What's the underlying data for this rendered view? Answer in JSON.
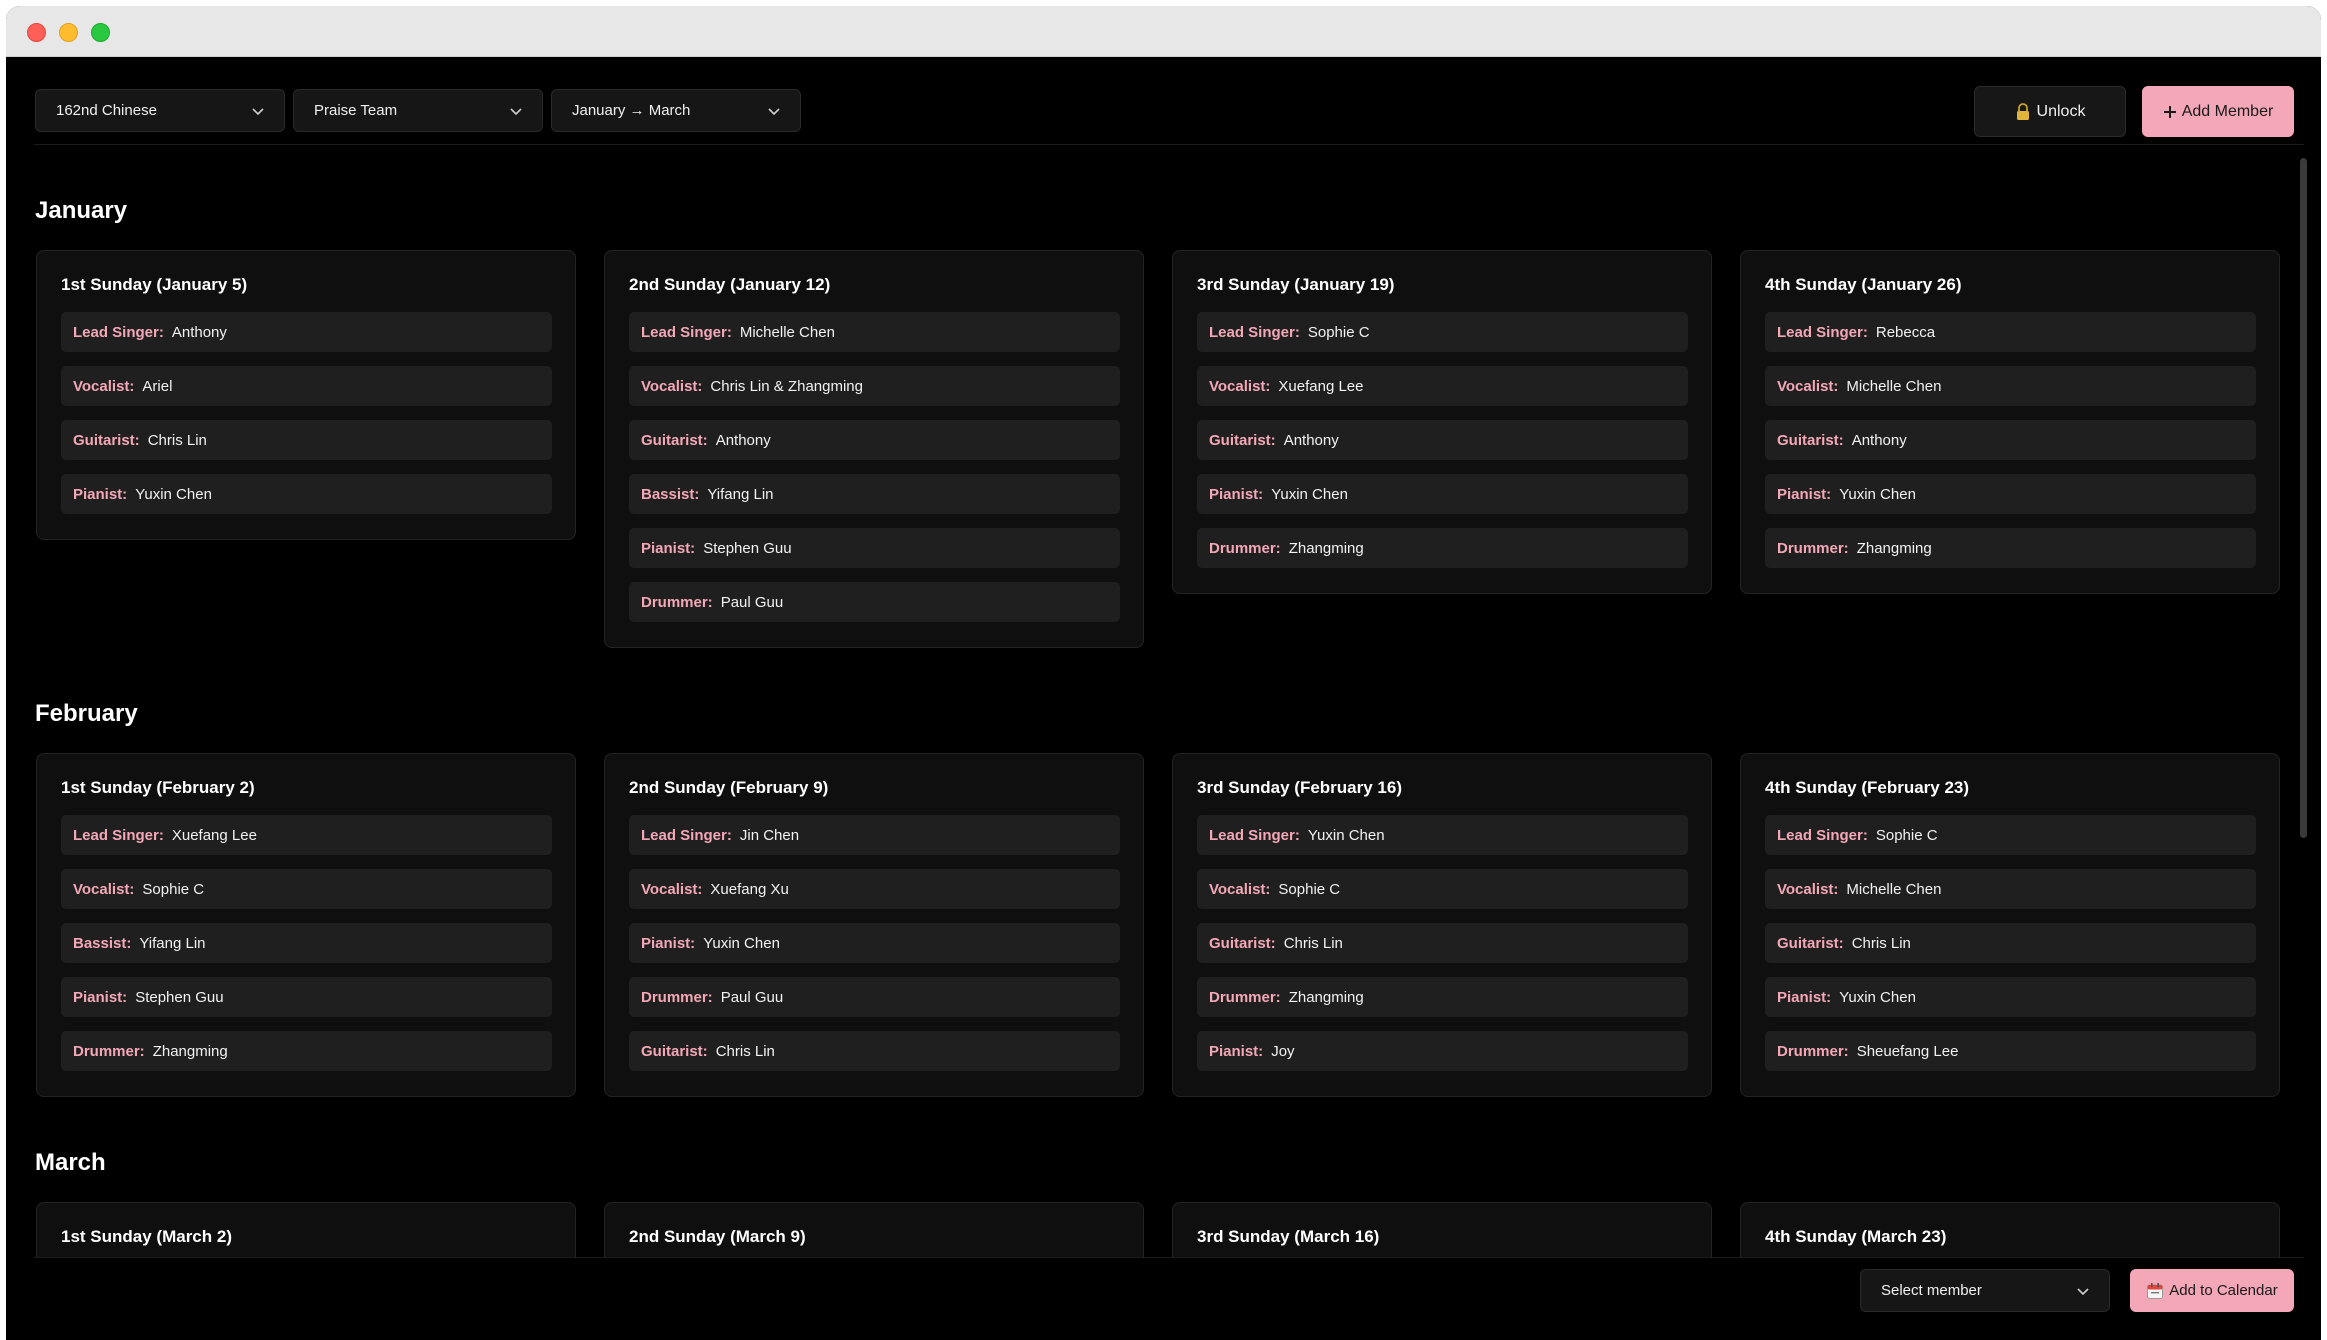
{
  "toolbar": {
    "filters": [
      "162nd Chinese",
      "Praise Team",
      "January → March"
    ],
    "unlock_label": "Unlock",
    "unlock_icon": "lock-icon",
    "add_member_label": "Add Member",
    "add_member_icon": "plus-icon"
  },
  "months": [
    {
      "name": "January",
      "sundays": [
        {
          "title": "1st Sunday (January 5)",
          "roles": [
            {
              "role": "Lead Singer:",
              "name": "Anthony"
            },
            {
              "role": "Vocalist:",
              "name": "Ariel"
            },
            {
              "role": "Guitarist:",
              "name": "Chris Lin"
            },
            {
              "role": "Pianist:",
              "name": "Yuxin Chen"
            }
          ]
        },
        {
          "title": "2nd Sunday (January 12)",
          "roles": [
            {
              "role": "Lead Singer:",
              "name": "Michelle Chen"
            },
            {
              "role": "Vocalist:",
              "name": "Chris Lin & Zhangming"
            },
            {
              "role": "Guitarist:",
              "name": "Anthony"
            },
            {
              "role": "Bassist:",
              "name": "Yifang Lin"
            },
            {
              "role": "Pianist:",
              "name": "Stephen Guu"
            },
            {
              "role": "Drummer:",
              "name": "Paul Guu"
            }
          ]
        },
        {
          "title": "3rd Sunday (January 19)",
          "roles": [
            {
              "role": "Lead Singer:",
              "name": "Sophie C"
            },
            {
              "role": "Vocalist:",
              "name": "Xuefang Lee"
            },
            {
              "role": "Guitarist:",
              "name": "Anthony"
            },
            {
              "role": "Pianist:",
              "name": "Yuxin Chen"
            },
            {
              "role": "Drummer:",
              "name": "Zhangming"
            }
          ]
        },
        {
          "title": "4th Sunday (January 26)",
          "roles": [
            {
              "role": "Lead Singer:",
              "name": "Rebecca"
            },
            {
              "role": "Vocalist:",
              "name": "Michelle Chen"
            },
            {
              "role": "Guitarist:",
              "name": "Anthony"
            },
            {
              "role": "Pianist:",
              "name": "Yuxin Chen"
            },
            {
              "role": "Drummer:",
              "name": "Zhangming"
            }
          ]
        }
      ]
    },
    {
      "name": "February",
      "sundays": [
        {
          "title": "1st Sunday (February 2)",
          "roles": [
            {
              "role": "Lead Singer:",
              "name": "Xuefang Lee"
            },
            {
              "role": "Vocalist:",
              "name": "Sophie C"
            },
            {
              "role": "Bassist:",
              "name": "Yifang Lin"
            },
            {
              "role": "Pianist:",
              "name": "Stephen Guu"
            },
            {
              "role": "Drummer:",
              "name": "Zhangming"
            }
          ]
        },
        {
          "title": "2nd Sunday (February 9)",
          "roles": [
            {
              "role": "Lead Singer:",
              "name": "Jin Chen"
            },
            {
              "role": "Vocalist:",
              "name": "Xuefang Xu"
            },
            {
              "role": "Pianist:",
              "name": "Yuxin Chen"
            },
            {
              "role": "Drummer:",
              "name": "Paul Guu"
            },
            {
              "role": "Guitarist:",
              "name": "Chris Lin"
            }
          ]
        },
        {
          "title": "3rd Sunday (February 16)",
          "roles": [
            {
              "role": "Lead Singer:",
              "name": "Yuxin Chen"
            },
            {
              "role": "Vocalist:",
              "name": "Sophie C"
            },
            {
              "role": "Guitarist:",
              "name": "Chris Lin"
            },
            {
              "role": "Drummer:",
              "name": "Zhangming"
            },
            {
              "role": "Pianist:",
              "name": "Joy"
            }
          ]
        },
        {
          "title": "4th Sunday (February 23)",
          "roles": [
            {
              "role": "Lead Singer:",
              "name": "Sophie C"
            },
            {
              "role": "Vocalist:",
              "name": "Michelle Chen"
            },
            {
              "role": "Guitarist:",
              "name": "Chris Lin"
            },
            {
              "role": "Pianist:",
              "name": "Yuxin Chen"
            },
            {
              "role": "Drummer:",
              "name": "Sheuefang Lee"
            }
          ]
        }
      ]
    },
    {
      "name": "March",
      "sundays": [
        {
          "title": "1st Sunday (March 2)",
          "roles": []
        },
        {
          "title": "2nd Sunday (March 9)",
          "roles": []
        },
        {
          "title": "3rd Sunday (March 16)",
          "roles": []
        },
        {
          "title": "4th Sunday (March 23)",
          "roles": []
        }
      ]
    }
  ],
  "bottom": {
    "select_member_label": "Select member",
    "add_calendar_label": "Add to Calendar",
    "add_calendar_icon": "calendar-icon"
  },
  "colors": {
    "accent": "#f4a7b6",
    "background": "#000000",
    "card": "#0f0f0f",
    "row": "#1f1f1f"
  }
}
